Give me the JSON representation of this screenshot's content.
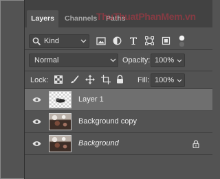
{
  "tabs": [
    {
      "label": "Layers",
      "active": true
    },
    {
      "label": "Channels",
      "active": false
    },
    {
      "label": "Paths",
      "active": false
    }
  ],
  "watermark": "ThuThuatPhanMem.vn",
  "filter": {
    "kind": "Kind",
    "icons": [
      "image-filter-icon",
      "adjustment-filter-icon",
      "type-filter-icon",
      "shape-filter-icon",
      "smart-object-filter-icon",
      "filter-toggle-icon"
    ]
  },
  "blend": {
    "mode": "Normal",
    "opacity_label": "Opacity:",
    "opacity_value": "100%"
  },
  "lock": {
    "label": "Lock:",
    "fill_label": "Fill:",
    "fill_value": "100%"
  },
  "layers": [
    {
      "name": "Layer 1",
      "selected": true,
      "italic": false,
      "locked": false
    },
    {
      "name": "Background copy",
      "selected": false,
      "italic": false,
      "locked": false
    },
    {
      "name": "Background",
      "selected": false,
      "italic": true,
      "locked": true
    }
  ],
  "colors": {
    "panel": "#535353",
    "selected_layer": "#6f6f6f",
    "watermark": "#be3746"
  }
}
